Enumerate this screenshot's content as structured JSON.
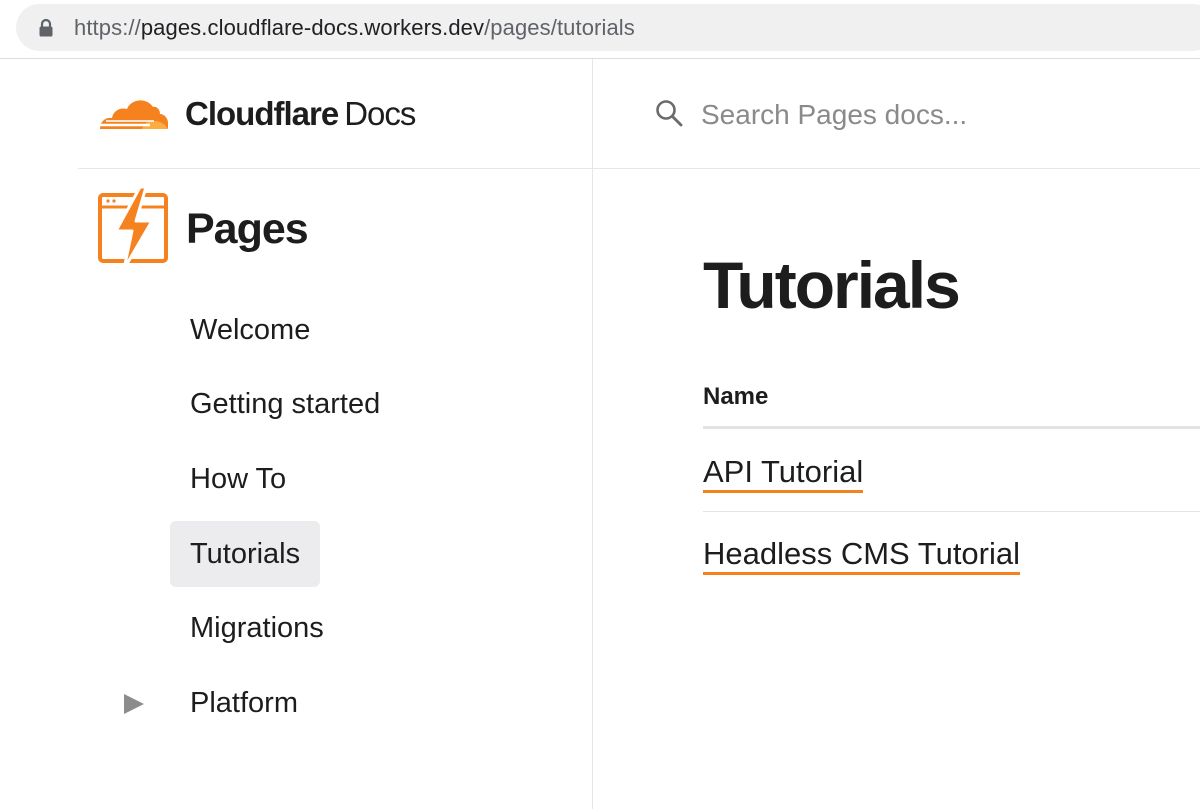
{
  "browser": {
    "url_scheme": "https://",
    "url_host": "pages.cloudflare-docs.workers.dev",
    "url_path": "/pages/tutorials",
    "lock_icon": "lock-icon"
  },
  "brand": {
    "name_bold": "Cloudflare",
    "name_light": "Docs",
    "logo_icon": "cloudflare-cloud-icon",
    "accent_color": "#f6821f"
  },
  "product": {
    "title": "Pages",
    "icon": "pages-lightning-icon"
  },
  "sidebar": {
    "items": [
      {
        "label": "Welcome",
        "active": false
      },
      {
        "label": "Getting started",
        "active": false
      },
      {
        "label": "How To",
        "active": false
      },
      {
        "label": "Tutorials",
        "active": true
      },
      {
        "label": "Migrations",
        "active": false
      },
      {
        "label": "Platform",
        "active": false,
        "expandable": true,
        "icon": "expand-triangle-icon"
      }
    ]
  },
  "search": {
    "placeholder": "Search Pages docs...",
    "value": "",
    "icon": "search-icon"
  },
  "main": {
    "title": "Tutorials",
    "table": {
      "header": "Name",
      "rows": [
        {
          "label": "API Tutorial"
        },
        {
          "label": "Headless CMS Tutorial"
        }
      ]
    }
  }
}
